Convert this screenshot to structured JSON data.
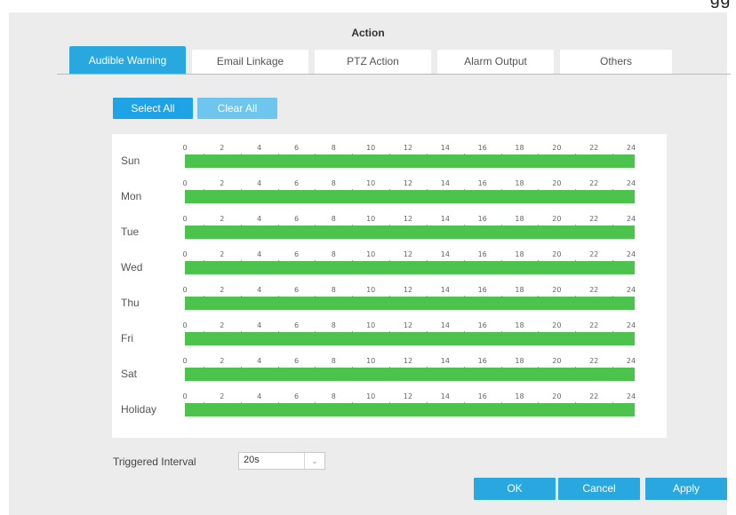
{
  "top_clip_text": "gg",
  "dialog": {
    "title": "Action"
  },
  "tabs": [
    {
      "label": "Audible Warning",
      "active": true
    },
    {
      "label": "Email Linkage",
      "active": false
    },
    {
      "label": "PTZ Action",
      "active": false
    },
    {
      "label": "Alarm Output",
      "active": false
    },
    {
      "label": "Others",
      "active": false
    }
  ],
  "buttons": {
    "select_all": "Select All",
    "clear_all": "Clear All",
    "ok": "OK",
    "cancel": "Cancel",
    "apply": "Apply"
  },
  "schedule": {
    "hour_ticks": [
      "0",
      "2",
      "4",
      "6",
      "8",
      "10",
      "12",
      "14",
      "16",
      "18",
      "20",
      "22",
      "24"
    ],
    "days": [
      {
        "label": "Sun",
        "armed_from": 0,
        "armed_to": 24
      },
      {
        "label": "Mon",
        "armed_from": 0,
        "armed_to": 24
      },
      {
        "label": "Tue",
        "armed_from": 0,
        "armed_to": 24
      },
      {
        "label": "Wed",
        "armed_from": 0,
        "armed_to": 24
      },
      {
        "label": "Thu",
        "armed_from": 0,
        "armed_to": 24
      },
      {
        "label": "Fri",
        "armed_from": 0,
        "armed_to": 24
      },
      {
        "label": "Sat",
        "armed_from": 0,
        "armed_to": 24
      },
      {
        "label": "Holiday",
        "armed_from": 0,
        "armed_to": 24
      }
    ],
    "bar_color": "#4cc34c"
  },
  "triggered_interval": {
    "label": "Triggered Interval",
    "value": "20s"
  },
  "colors": {
    "accent": "#29a8e0",
    "clear_button": "#6ec6ef",
    "panel_bg": "#ececec"
  }
}
